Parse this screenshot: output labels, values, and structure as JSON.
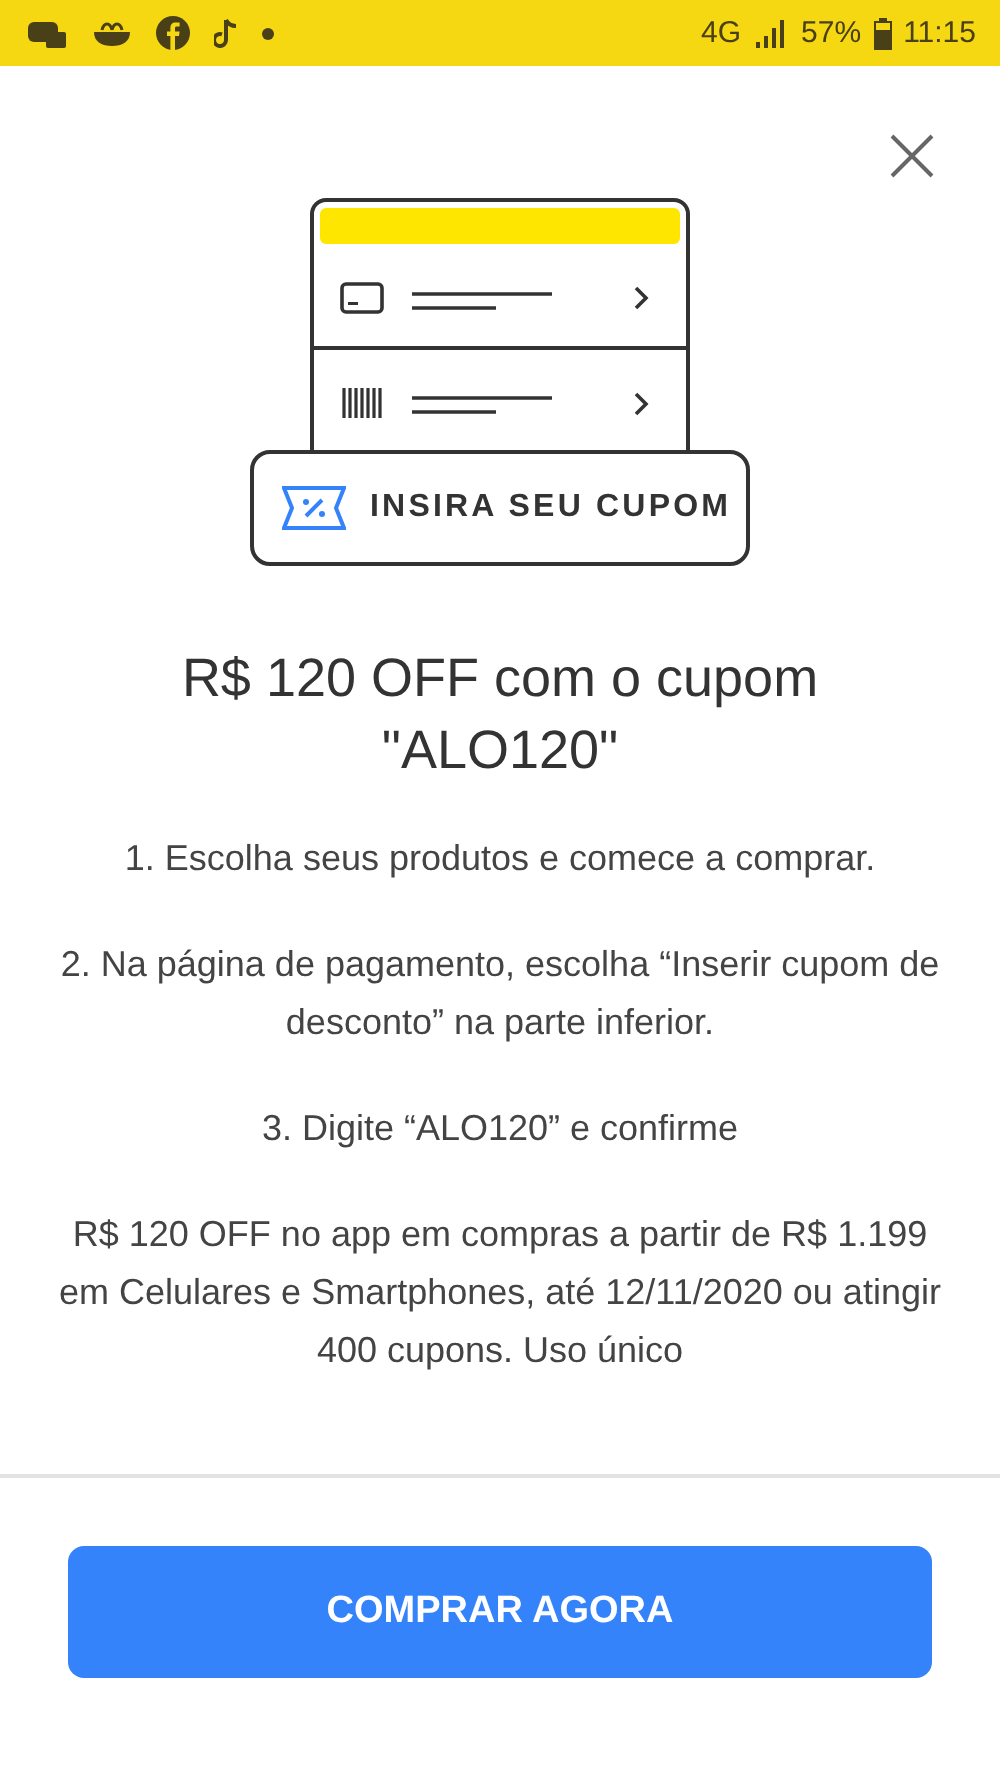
{
  "status_bar": {
    "battery": "57%",
    "time": "11:15",
    "network": "4G"
  },
  "illustration": {
    "coupon_label": "INSIRA SEU CUPOM"
  },
  "title": "R$ 120 OFF com o cupom \"ALO120\"",
  "paragraphs": [
    "1. Escolha seus produtos e comece a comprar.",
    "2. Na página de pagamento, escolha “Inserir cupom de desconto” na parte inferior.",
    "3. Digite “ALO120” e confirme",
    "R$ 120 OFF no app em compras a partir de R$ 1.199 em Celulares e Smartphones, até 12/11/2020 ou atingir 400 cupons. Uso único"
  ],
  "button": {
    "label": "COMPRAR AGORA"
  }
}
